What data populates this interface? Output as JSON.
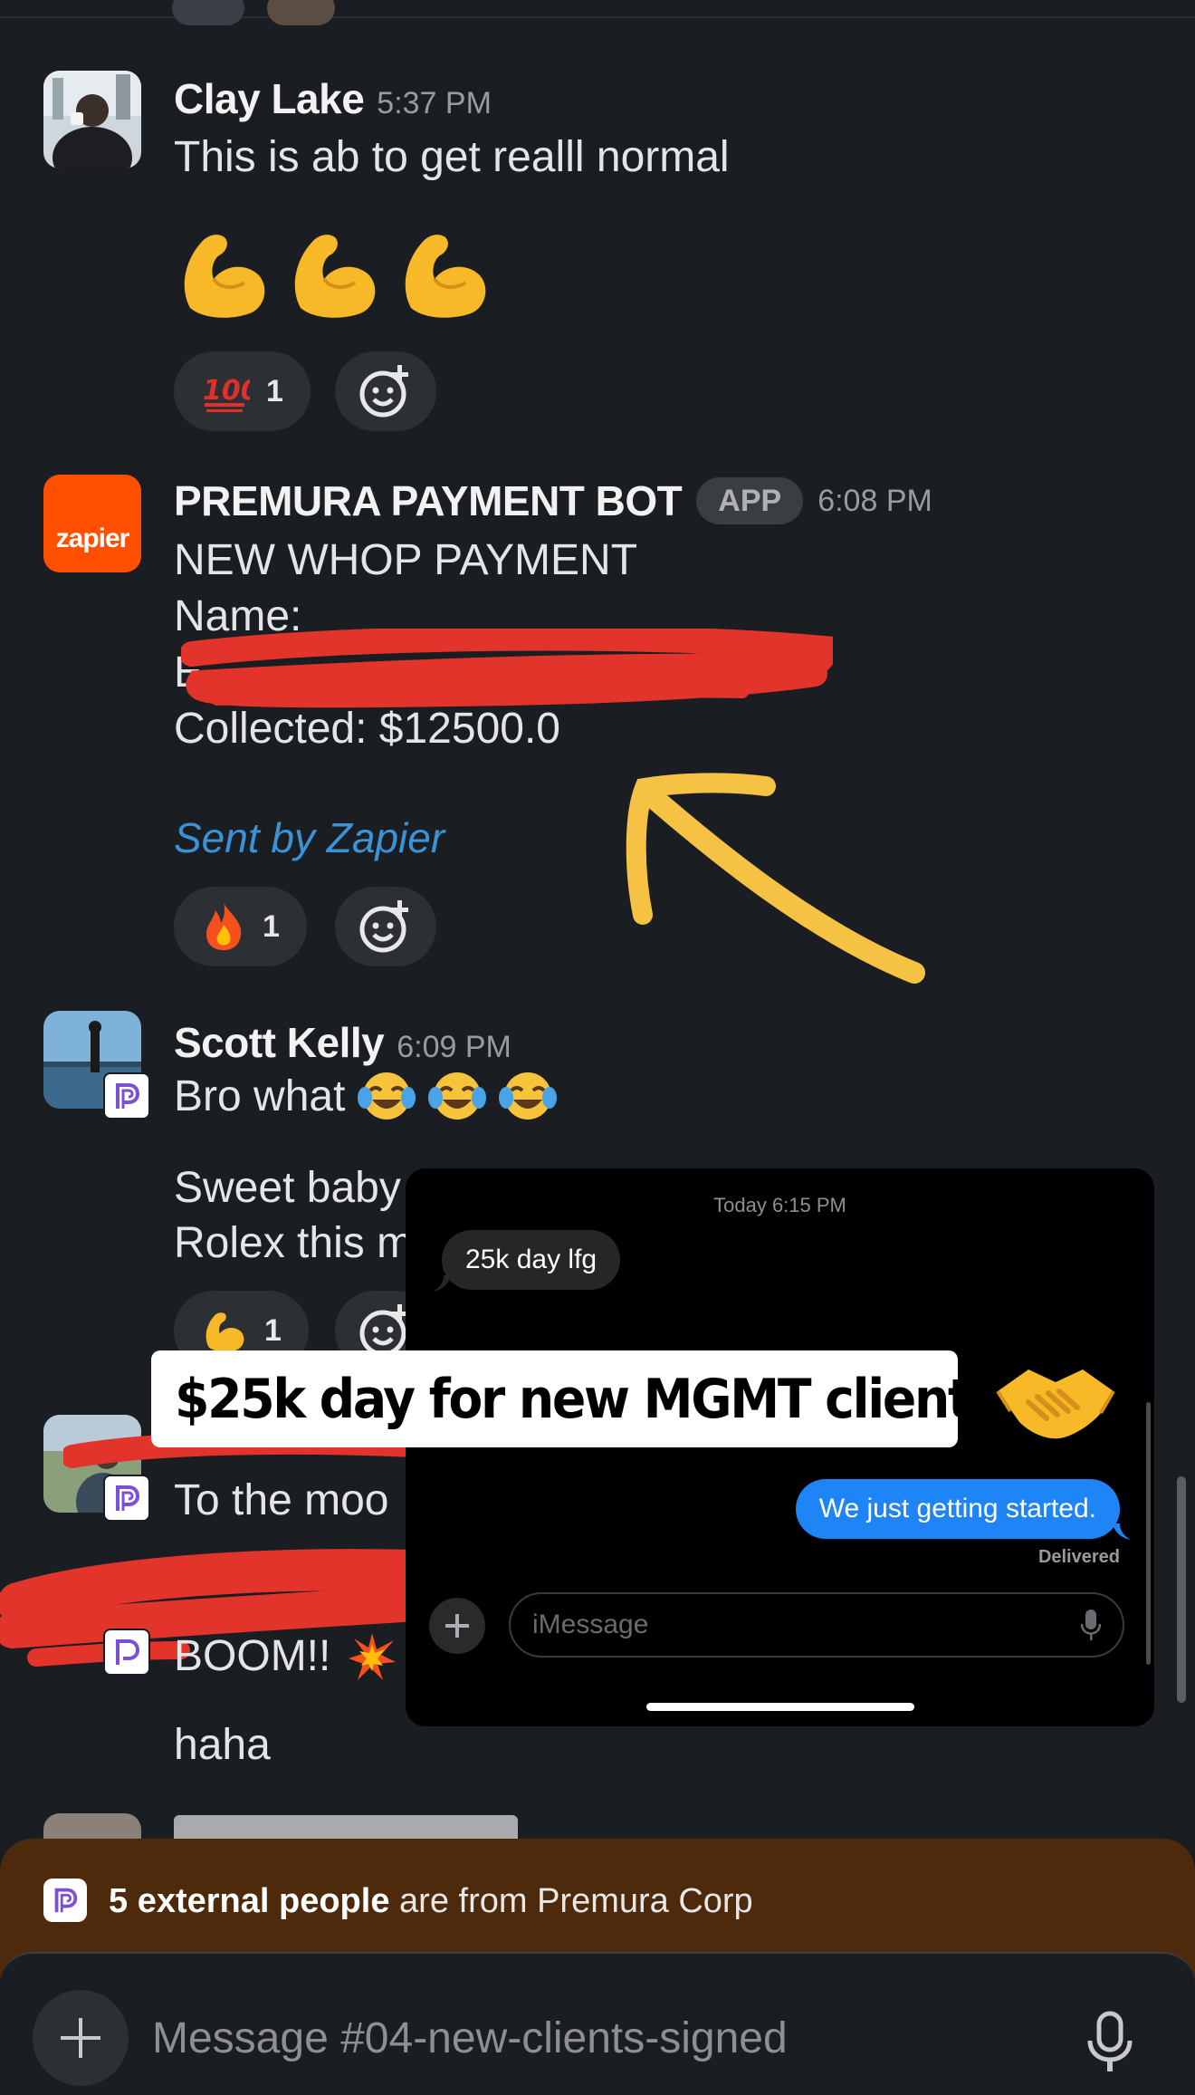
{
  "colors": {
    "background": "#1a1d21",
    "link": "#3b93d6",
    "imessage_blue": "#1f84f5",
    "banner": "#4c2a0b",
    "redaction": "#e2342a",
    "annotation_arrow": "#f6c244"
  },
  "messages": [
    {
      "author": "Clay Lake",
      "time": "5:37 PM",
      "avatar": "avatar-photo",
      "lines": [
        "This is ab to get realll normal"
      ],
      "big_emoji": [
        "flexed-biceps",
        "flexed-biceps",
        "flexed-biceps"
      ],
      "reactions": [
        {
          "emoji": "hundred-points",
          "count": "1"
        }
      ]
    },
    {
      "author": "PREMURA PAYMENT BOT",
      "badge": "APP",
      "time": "6:08 PM",
      "avatar_label": "zapier",
      "lines": [
        "NEW WHOP PAYMENT",
        "Name:",
        "Collected: $12500.0"
      ],
      "footer": "Sent by Zapier",
      "reactions": [
        {
          "emoji": "fire",
          "count": "1"
        }
      ]
    },
    {
      "author": "Scott Kelly",
      "time": "6:09 PM",
      "lines": [
        "Bro what",
        "Sweet baby",
        "Rolex this m"
      ],
      "reactions": [
        {
          "emoji": "flexed-biceps",
          "count": "1"
        }
      ]
    },
    {
      "lines": [
        "To the moo"
      ]
    },
    {
      "lines": [
        "BOOM!!",
        "haha"
      ]
    }
  ],
  "imessage": {
    "timestamp": "Today 6:15 PM",
    "incoming": "25k day lfg",
    "outgoing": "We just getting started.",
    "status": "Delivered",
    "placeholder": "iMessage"
  },
  "caption": {
    "text": "$25k day for new MGMT client"
  },
  "banner": {
    "bold": "5 external people",
    "rest": " are from Premura Corp"
  },
  "composer": {
    "placeholder": "Message #04-new-clients-signed"
  }
}
